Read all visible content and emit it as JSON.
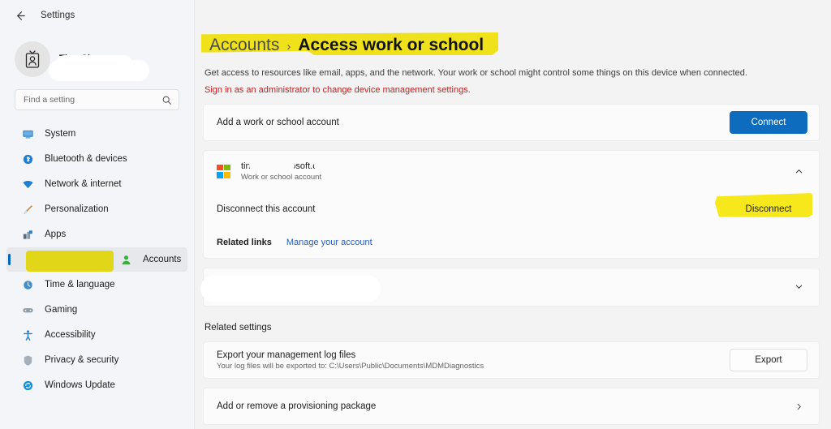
{
  "window": {
    "back_label": "back-arrow",
    "app_title": "Settings"
  },
  "profile": {
    "name": "Tina Chen",
    "email": "",
    "avatar_icon": "id-badge-icon"
  },
  "search": {
    "placeholder": "Find a setting",
    "value": "",
    "icon": "search-icon"
  },
  "sidebar": {
    "items": [
      {
        "label": "System",
        "icon": "monitor-icon",
        "selected": false
      },
      {
        "label": "Bluetooth & devices",
        "icon": "bluetooth-icon",
        "selected": false
      },
      {
        "label": "Network & internet",
        "icon": "wifi-icon",
        "selected": false
      },
      {
        "label": "Personalization",
        "icon": "paintbrush-icon",
        "selected": false
      },
      {
        "label": "Apps",
        "icon": "apps-icon",
        "selected": false
      },
      {
        "label": "Accounts",
        "icon": "person-icon",
        "selected": true
      },
      {
        "label": "Time & language",
        "icon": "clock-icon",
        "selected": false
      },
      {
        "label": "Gaming",
        "icon": "gamepad-icon",
        "selected": false
      },
      {
        "label": "Accessibility",
        "icon": "accessibility-icon",
        "selected": false
      },
      {
        "label": "Privacy & security",
        "icon": "shield-icon",
        "selected": false
      },
      {
        "label": "Windows Update",
        "icon": "update-icon",
        "selected": false
      }
    ]
  },
  "breadcrumb": {
    "parent": "Accounts",
    "separator": "›",
    "current": "Access work or school"
  },
  "page": {
    "description": "Get access to resources like email, apps, and the network. Your work or school might control some things on this device when connected.",
    "warning": "Sign in as an administrator to change device management settings."
  },
  "add_account": {
    "label": "Add a work or school account",
    "button": "Connect"
  },
  "account": {
    "email_prefix": "tin@l",
    "email_suffix": ".onmicrosoft.com",
    "subtitle": "Work or school account",
    "logo_icon": "microsoft-logo-icon",
    "chevron_icon": "chevron-up-icon",
    "disconnect_label": "Disconnect this account",
    "disconnect_button": "Disconnect",
    "related_links_label": "Related links",
    "manage_link": "Manage your account"
  },
  "collapsed_account": {
    "label": "",
    "chevron_icon": "chevron-down-icon"
  },
  "related_settings": {
    "heading": "Related settings",
    "export": {
      "title": "Export your management log files",
      "subtitle": "Your log files will be exported to: C:\\Users\\Public\\Documents\\MDMDiagnostics",
      "button": "Export"
    },
    "provisioning": {
      "title": "Add or remove a provisioning package",
      "chevron_icon": "chevron-right-icon"
    }
  },
  "colors": {
    "accent": "#0d6cbd",
    "highlight": "#fbec1b",
    "warning": "#c22222",
    "link": "#2a5db0"
  }
}
